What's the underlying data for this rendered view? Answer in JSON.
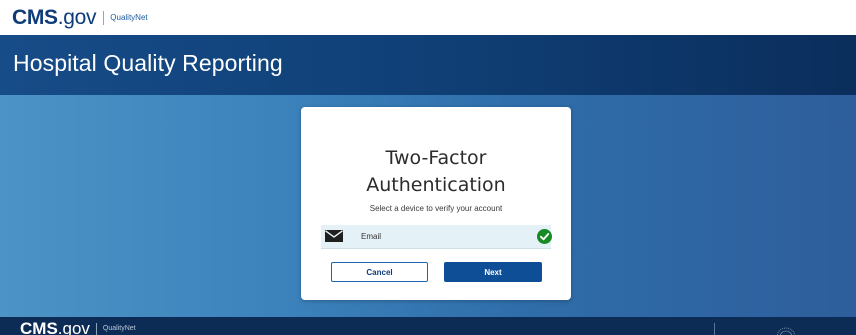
{
  "header": {
    "cms_logo": {
      "bold": "CMS",
      "light": ".gov"
    },
    "qualitynet_logo": "QualityNet"
  },
  "banner": {
    "title": "Hospital Quality Reporting"
  },
  "card": {
    "title_line1": "Two-Factor",
    "title_line2": "Authentication",
    "subtitle": "Select a device to verify your account",
    "device": {
      "label": "Email",
      "icon": "envelope-icon",
      "selected": true,
      "status_icon": "check-circle-icon",
      "status_color": "#178a24"
    },
    "cancel_label": "Cancel",
    "next_label": "Next"
  },
  "footer": {
    "cms_logo": {
      "bold": "CMS",
      "light": ".gov"
    },
    "qualitynet_logo": "QualityNet"
  },
  "colors": {
    "brand_navy": "#0d3c78",
    "primary_button": "#0d4e97",
    "selected_row": "#e4f1f6",
    "footer": "#0d2c55"
  }
}
